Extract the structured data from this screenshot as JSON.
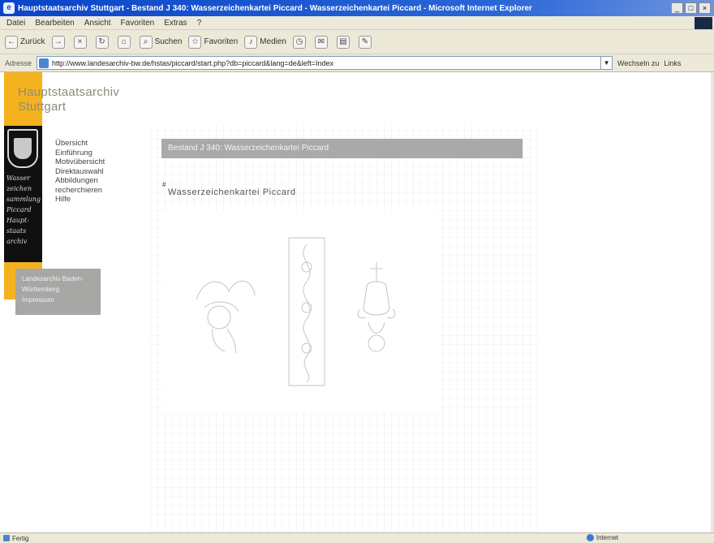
{
  "window": {
    "title": "Hauptstaatsarchiv Stuttgart - Bestand J 340: Wasserzeichenkartei Piccard - Wasserzeichenkartei Piccard - Microsoft Internet Explorer",
    "controls": [
      "_",
      "□",
      "×"
    ]
  },
  "menu": [
    "Datei",
    "Bearbeiten",
    "Ansicht",
    "Favoriten",
    "Extras",
    "?"
  ],
  "toolbar": {
    "back": "Zurück",
    "forward": "",
    "stop": "",
    "refresh": "",
    "home": "",
    "search": "Suchen",
    "favorites": "Favoriten",
    "media": "Medien"
  },
  "address": {
    "label": "Adresse",
    "url": "http://www.landesarchiv-bw.de/hstas/piccard/start.php?db=piccard&lang=de&left=Index",
    "go": "Wechseln zu",
    "links": "Links"
  },
  "site": {
    "title_line1": "Hauptstaatsarchiv",
    "title_line2": "Stuttgart",
    "handwriting": [
      "Wasser",
      "zeichen",
      "sammlung",
      "Piccard",
      "Haupt-",
      "staats",
      "archiv"
    ]
  },
  "nav": [
    "Übersicht",
    "Einführung",
    "Motivübersicht",
    "Direktauswahl",
    "Abbildungen",
    "recherchieren",
    "Hilfe"
  ],
  "infobox": {
    "line1": "Landesarchiv Baden-",
    "line2": "Württemberg",
    "line3": "Impressum"
  },
  "main": {
    "header": "Bestand J 340: Wasserzeichenkartei Piccard",
    "pagemark": "#",
    "subtitle": "Wasserzeichenkartei Piccard"
  },
  "status": {
    "left": "Fertig",
    "zone": "Internet"
  }
}
